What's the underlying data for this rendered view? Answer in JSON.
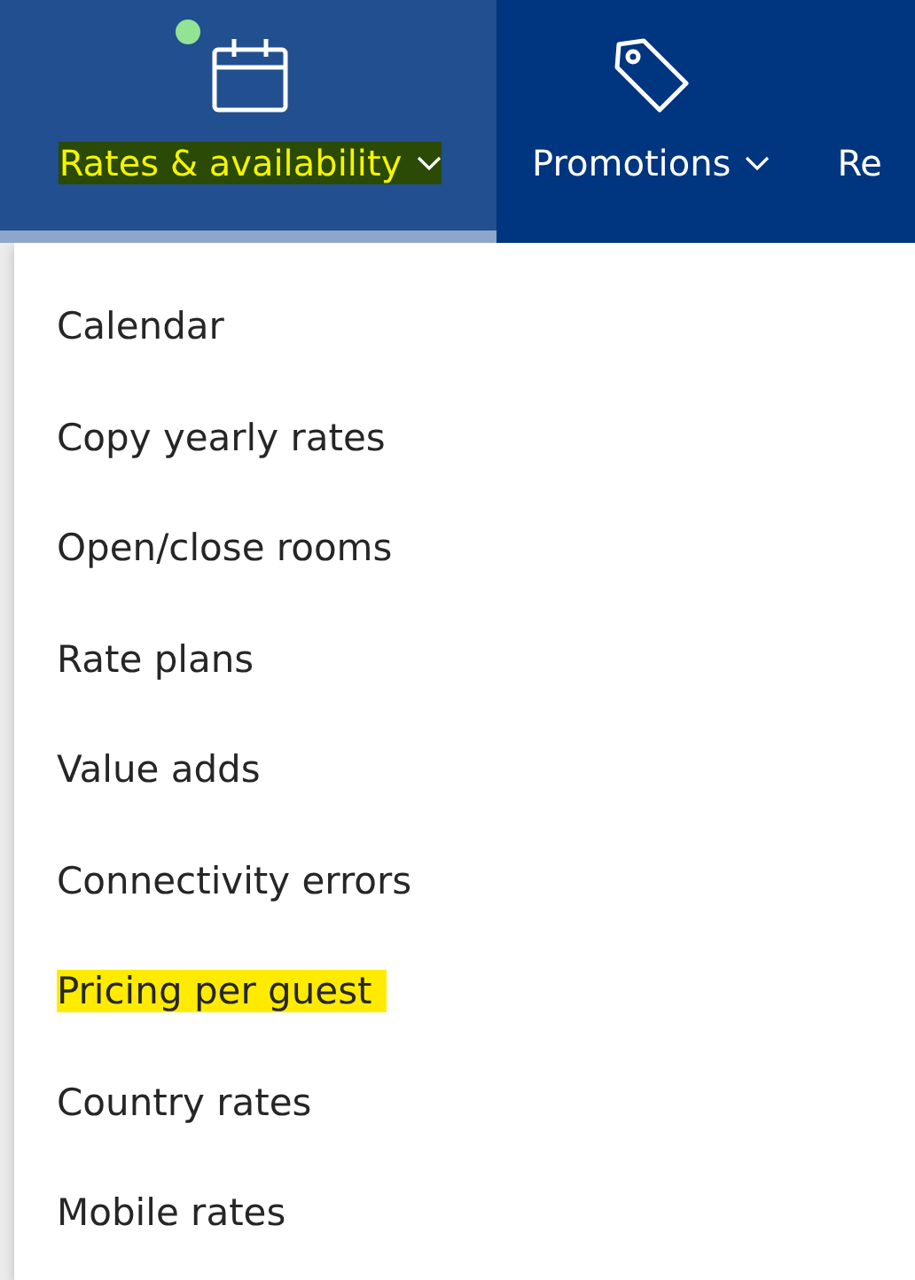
{
  "nav_tabs": [
    {
      "label": "Rates & availability",
      "kind": "calendar",
      "selected": true,
      "notification": true,
      "highlighted": true,
      "dropdown": true
    },
    {
      "label": "Promotions",
      "kind": "tag",
      "selected": false,
      "notification": false,
      "highlighted": false,
      "dropdown": true
    },
    {
      "label": "Re",
      "kind": "text",
      "selected": false,
      "notification": false,
      "highlighted": false,
      "dropdown": false
    }
  ],
  "menu_items": [
    {
      "label": "Calendar",
      "highlighted": false
    },
    {
      "label": "Copy yearly rates",
      "highlighted": false
    },
    {
      "label": "Open/close rooms",
      "highlighted": false
    },
    {
      "label": "Rate plans",
      "highlighted": false
    },
    {
      "label": "Value adds",
      "highlighted": false
    },
    {
      "label": "Connectivity errors",
      "highlighted": false
    },
    {
      "label": "Pricing per guest",
      "highlighted": true
    },
    {
      "label": "Country rates",
      "highlighted": false
    },
    {
      "label": "Mobile rates",
      "highlighted": false
    }
  ]
}
